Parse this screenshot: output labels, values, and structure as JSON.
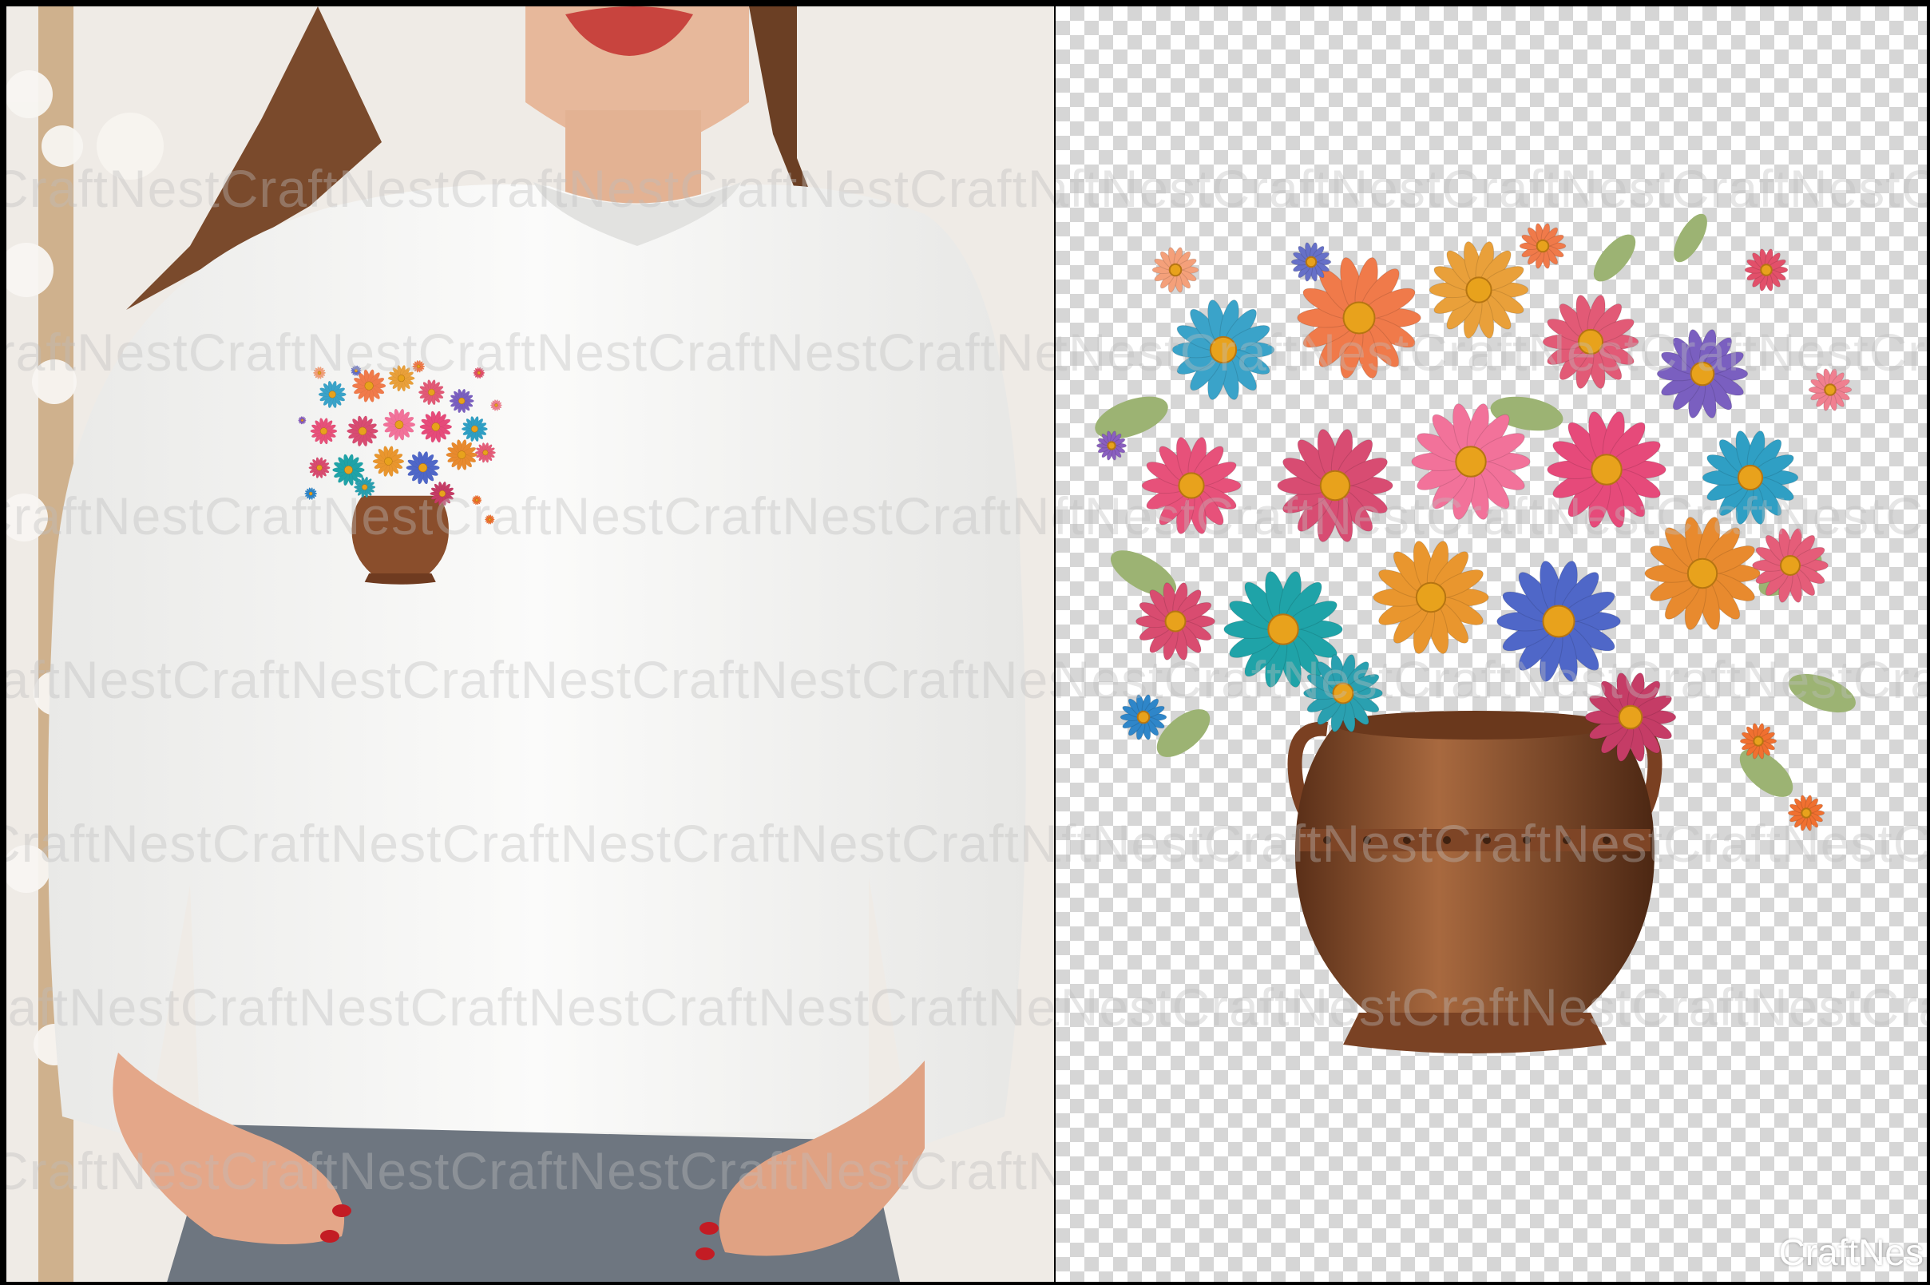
{
  "watermark": {
    "text": "CraftNestCraftNestCraftNestCraftNestCraftNestCraftNestCraftNest",
    "corner_text": "CraftNes"
  },
  "colors": {
    "sweatshirt": "#f7f7f5",
    "vase": "#8a4e2c",
    "checker": "#d6d6d6"
  },
  "icons": [
    "flower-vase-graphic",
    "woman-sweatshirt-photo",
    "transparent-checkerboard"
  ]
}
